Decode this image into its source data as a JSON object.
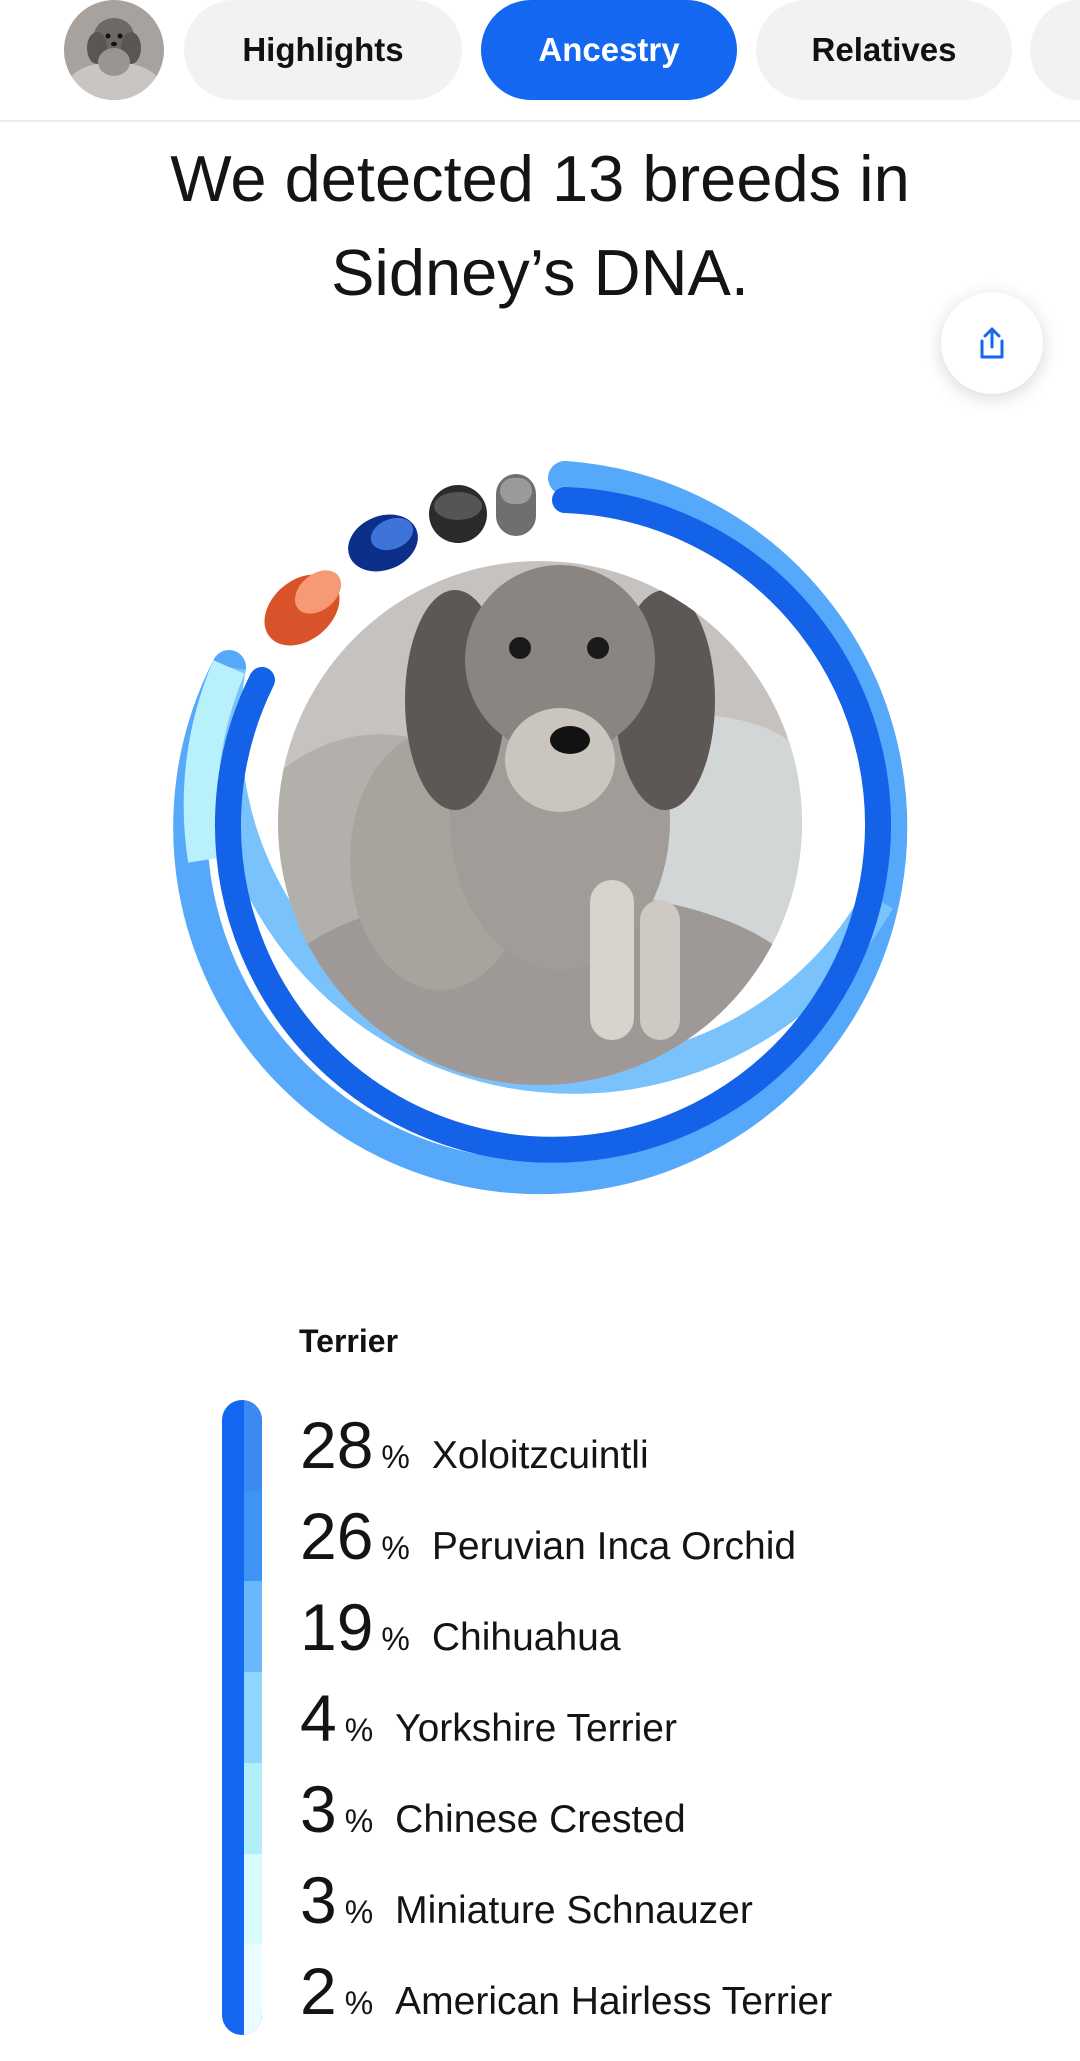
{
  "nav": {
    "tabs": [
      {
        "label": "Highlights",
        "active": false
      },
      {
        "label": "Ancestry",
        "active": true
      },
      {
        "label": "Relatives",
        "active": false
      }
    ]
  },
  "headline": {
    "line1": "We detected 13 breeds in",
    "line2": "Sidney’s DNA."
  },
  "share_icon": "share-icon",
  "ring_chart": {
    "segments": [
      {
        "color": "#f07a4a"
      },
      {
        "color": "#1a3f9e"
      },
      {
        "color": "#444444"
      },
      {
        "color": "#8c8c8c"
      },
      {
        "color": "#4a9bf7"
      },
      {
        "color": "#7cc6fa"
      },
      {
        "color": "#b6f0fb"
      }
    ]
  },
  "ancestry_group": {
    "title": "Terrier",
    "breeds": [
      {
        "percent": "28",
        "symbol": "%",
        "name": "Xoloitzcuintli",
        "color": "#3b8af2"
      },
      {
        "percent": "26",
        "symbol": "%",
        "name": "Peruvian Inca Orchid",
        "color": "#3f93f6"
      },
      {
        "percent": "19",
        "symbol": "%",
        "name": "Chihuahua",
        "color": "#68b8fb"
      },
      {
        "percent": "4",
        "symbol": "%",
        "name": "Yorkshire Terrier",
        "color": "#8ed6fb"
      },
      {
        "percent": "3",
        "symbol": "%",
        "name": "Chinese Crested",
        "color": "#b3effb"
      },
      {
        "percent": "3",
        "symbol": "%",
        "name": "Miniature Schnauzer",
        "color": "#d7fbff"
      },
      {
        "percent": "2",
        "symbol": "%",
        "name": "American Hairless Terrier",
        "color": "#eafcff"
      }
    ]
  },
  "colors": {
    "accent": "#1467f0",
    "group_bar": "#1467f0"
  }
}
